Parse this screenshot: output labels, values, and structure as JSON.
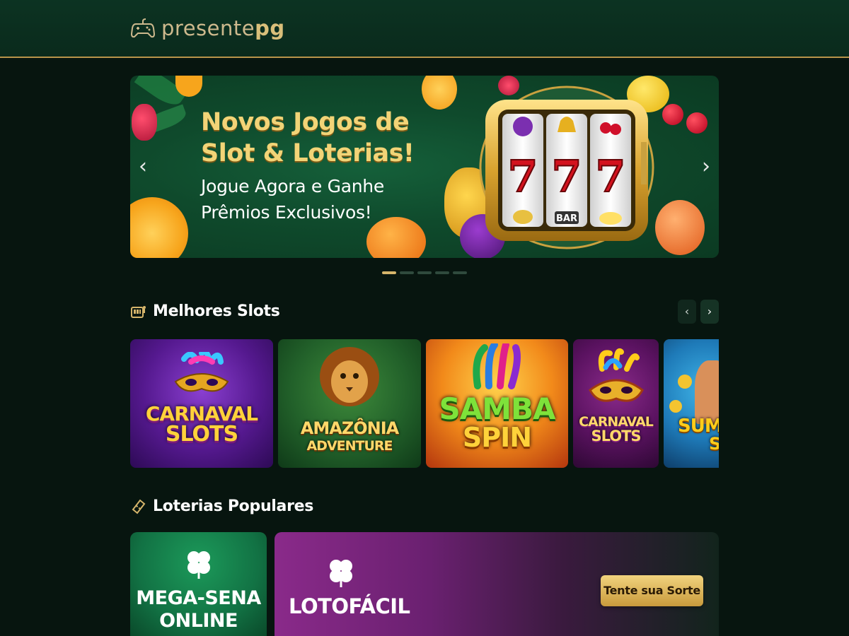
{
  "header": {
    "logo_light": "presente",
    "logo_bold": "pg"
  },
  "banner": {
    "title_line1": "Novos Jogos de",
    "title_line2": "Slot & Loterias!",
    "subtitle_line1": "Jogue Agora e Ganhe",
    "subtitle_line2": "Prêmios Exclusivos!",
    "reel_symbol": "7",
    "bar_label": "BAR",
    "prev_arrow": "‹",
    "next_arrow": "›",
    "slide_count": 5,
    "active_slide": 1
  },
  "slots_section": {
    "title": "Melhores Slots",
    "prev": "‹",
    "next": "›",
    "games": [
      {
        "line1": "CARNAVAL",
        "line2": "SLOTS"
      },
      {
        "line1": "AMAZÔNIA",
        "line2": "ADVENTURE"
      },
      {
        "line1": "SAMBA",
        "line2": "SPIN"
      },
      {
        "line1": "CARNAVAL",
        "line2": "SLOTS"
      },
      {
        "line1": "SUMM",
        "line2": "SP"
      }
    ]
  },
  "lotteries_section": {
    "title": "Loterias Populares",
    "items": [
      {
        "line1": "MEGA-SENA",
        "line2": "ONLINE"
      },
      {
        "line1": "LOTOFÁCIL"
      }
    ],
    "cta_label": "Tente sua Sorte"
  },
  "colors": {
    "accent_gold": "#d6b56b",
    "header_green": "#0c3322",
    "page_bg": "#07150f"
  },
  "icons": [
    "gamepad-icon",
    "slot-machine-icon",
    "lottery-ticket-icon",
    "clover-icon",
    "chevron-left-icon",
    "chevron-right-icon"
  ]
}
